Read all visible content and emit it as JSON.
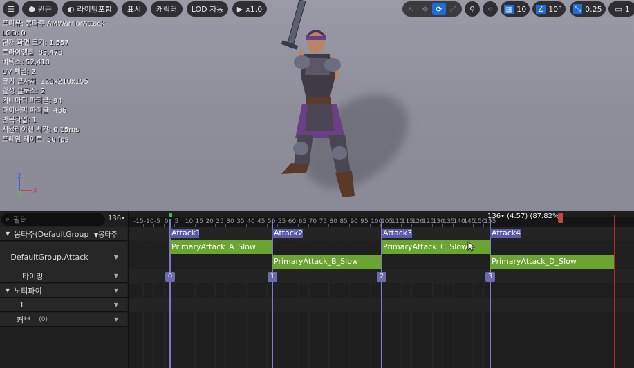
{
  "toolbar": {
    "menu_icon": "hamburger-icon",
    "perspective_label": "원근",
    "lighting_label": "라이팅포함",
    "show_label": "표시",
    "character_label": "캐릭터",
    "lod_label": "LOD 자동",
    "play_speed_label": "x1.0",
    "grid_value": "10",
    "angle_value": "10°",
    "scale_value": "0.25",
    "camera_value": "1",
    "accent_color": "#1d6fd6"
  },
  "stats": [
    "프리뷰: 몽타주 AMWarriorAttack",
    "LOD: 0",
    "현재 화면 크기: 1.557",
    "트라이앵글: 85,473",
    "버텍스: 52,410",
    "UV 채널: 2",
    "크기 근사치: 129x210x195",
    "활성 클로스: 2",
    "키네마틱 파티클: 94",
    "다이내믹 파티클: 436",
    "반복작업: 1",
    "시뮬레이션 시간: 0.15ms",
    "프레임 레이트: 30 fps"
  ],
  "axis": {
    "z": "Z",
    "x": "X",
    "y": "Y"
  },
  "sequencer": {
    "search_placeholder": "필터",
    "frame_count": "136•",
    "rows": {
      "montage": "몽타주(DefaultGroup",
      "montage_dropdown": "몽타주",
      "slot": "DefaultGroup.Attack",
      "timing": "타이밍",
      "notify": "노티파이",
      "notify_track": "1",
      "curves": "커브",
      "curves_count": "(0)"
    },
    "ruler_labels": [
      "-15",
      "-10",
      "-5",
      "0",
      "5",
      "10",
      "15",
      "20",
      "25",
      "30",
      "35",
      "40",
      "45",
      "50",
      "55",
      "60",
      "65",
      "70",
      "75",
      "80",
      "85",
      "90",
      "95",
      "100",
      "105",
      "110",
      "115",
      "120",
      "125",
      "130",
      "135",
      "140",
      "145",
      "150",
      "155"
    ],
    "playhead_label": "136• (4.57) (87.82%)",
    "sections": [
      "Attack1",
      "Attack2",
      "Attack3",
      "Attack4"
    ],
    "clips": [
      "PrimaryAttack_A_Slow",
      "PrimaryAttack_B_Slow",
      "PrimaryAttack_C_Slow",
      "PrimaryAttack_D_Slow"
    ],
    "timing_markers": [
      "0",
      "1",
      "2",
      "3"
    ],
    "clip_color": "#6aa532",
    "section_color": "#5c5aa8",
    "end_marker_color": "#c0483f"
  }
}
